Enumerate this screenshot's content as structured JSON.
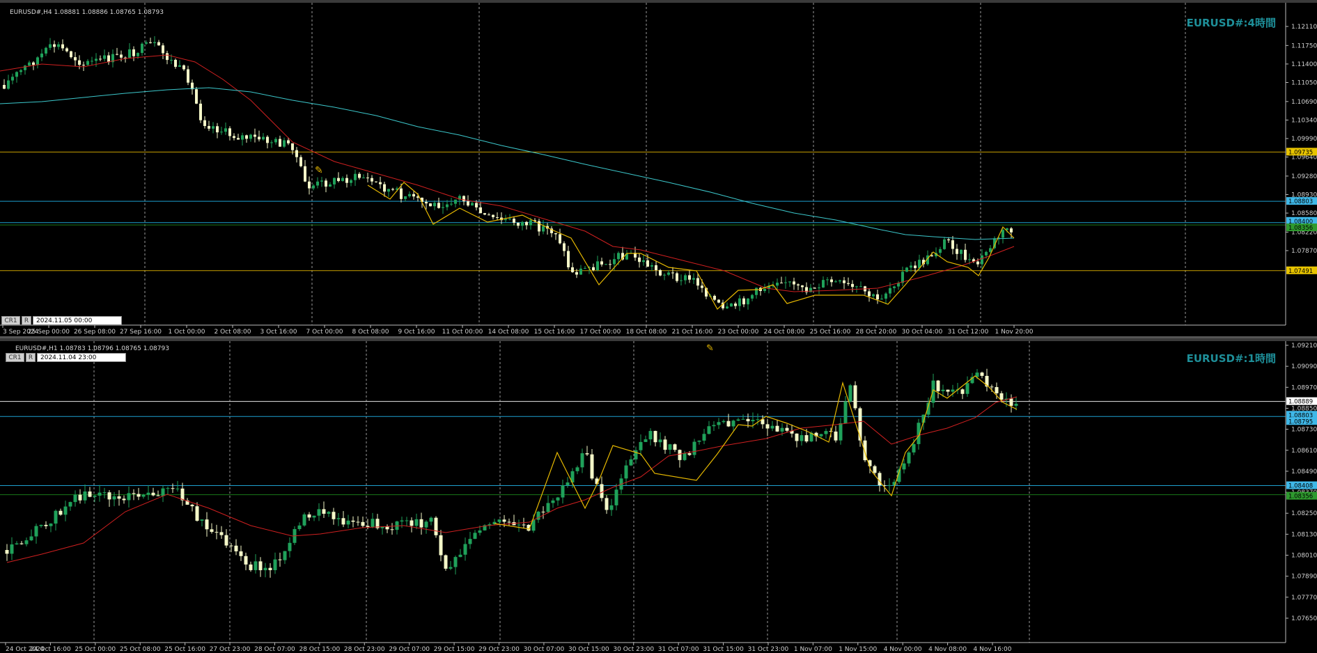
{
  "top": {
    "header": "EURUSD#,H4  1.08881 1.08886 1.08765 1.08793",
    "watermark": "EURUSD#:4時間",
    "date_field": "2024.11.05 00:00",
    "btn_cr": "CR1",
    "btn_r": "R",
    "price_ticks": [
      "1.12110",
      "1.11750",
      "1.11400",
      "1.11050",
      "1.10690",
      "1.10340",
      "1.09990",
      "1.09640",
      "1.09280",
      "1.08930",
      "1.08580",
      "1.08220",
      "1.07870"
    ],
    "tags": [
      "1.09735",
      "1.08803",
      "1.08400",
      "1.08356",
      "1.07491"
    ],
    "time_ticks": [
      "3 Sep 2024",
      "25 Sep 00:00",
      "26 Sep 08:00",
      "27 Sep 16:00",
      "1 Oct 00:00",
      "2 Oct 08:00",
      "3 Oct 16:00",
      "7 Oct 00:00",
      "8 Oct 08:00",
      "9 Oct 16:00",
      "11 Oct 00:00",
      "14 Oct 08:00",
      "15 Oct 16:00",
      "17 Oct 00:00",
      "18 Oct 08:00",
      "21 Oct 16:00",
      "23 Oct 00:00",
      "24 Oct 08:00",
      "25 Oct 16:00",
      "28 Oct 20:00",
      "30 Oct 04:00",
      "31 Oct 12:00",
      "1 Nov 20:00"
    ]
  },
  "bottom": {
    "header": "EURUSD#,H1  1.08783 1.08796 1.08765 1.08793",
    "watermark": "EURUSD#:1時間",
    "date_field": "2024.11.04 23:00",
    "btn_cr": "CR1",
    "btn_r": "R",
    "price_ticks": [
      "1.09210",
      "1.09090",
      "1.08970",
      "1.08850",
      "1.08730",
      "1.08610",
      "1.08490",
      "1.08370",
      "1.08250",
      "1.08130",
      "1.08010",
      "1.07890",
      "1.07770",
      "1.07650"
    ],
    "tags": [
      "1.08889",
      "1.08803",
      "1.08795",
      "1.08408",
      "1.08356"
    ],
    "time_ticks": [
      "24 Oct 2024",
      "24 Oct 16:00",
      "25 Oct 00:00",
      "25 Oct 08:00",
      "25 Oct 16:00",
      "27 Oct 23:00",
      "28 Oct 07:00",
      "28 Oct 15:00",
      "28 Oct 23:00",
      "29 Oct 07:00",
      "29 Oct 15:00",
      "29 Oct 23:00",
      "30 Oct 07:00",
      "30 Oct 15:00",
      "30 Oct 23:00",
      "31 Oct 07:00",
      "31 Oct 15:00",
      "31 Oct 23:00",
      "1 Nov 07:00",
      "1 Nov 15:00",
      "4 Nov 00:00",
      "4 Nov 08:00",
      "4 Nov 16:00"
    ]
  },
  "colors": {
    "bull": "#1fa15a",
    "bear": "#f4f7c8",
    "ma_red": "#d02020",
    "ma_cyan": "#3cc8cc",
    "zigzag": "#e6b800",
    "hline_yellow": "#c8a000",
    "hline_blue": "#1ea0d0",
    "hline_green": "#1a7a1a",
    "hline_white": "#e8e8e8"
  }
}
